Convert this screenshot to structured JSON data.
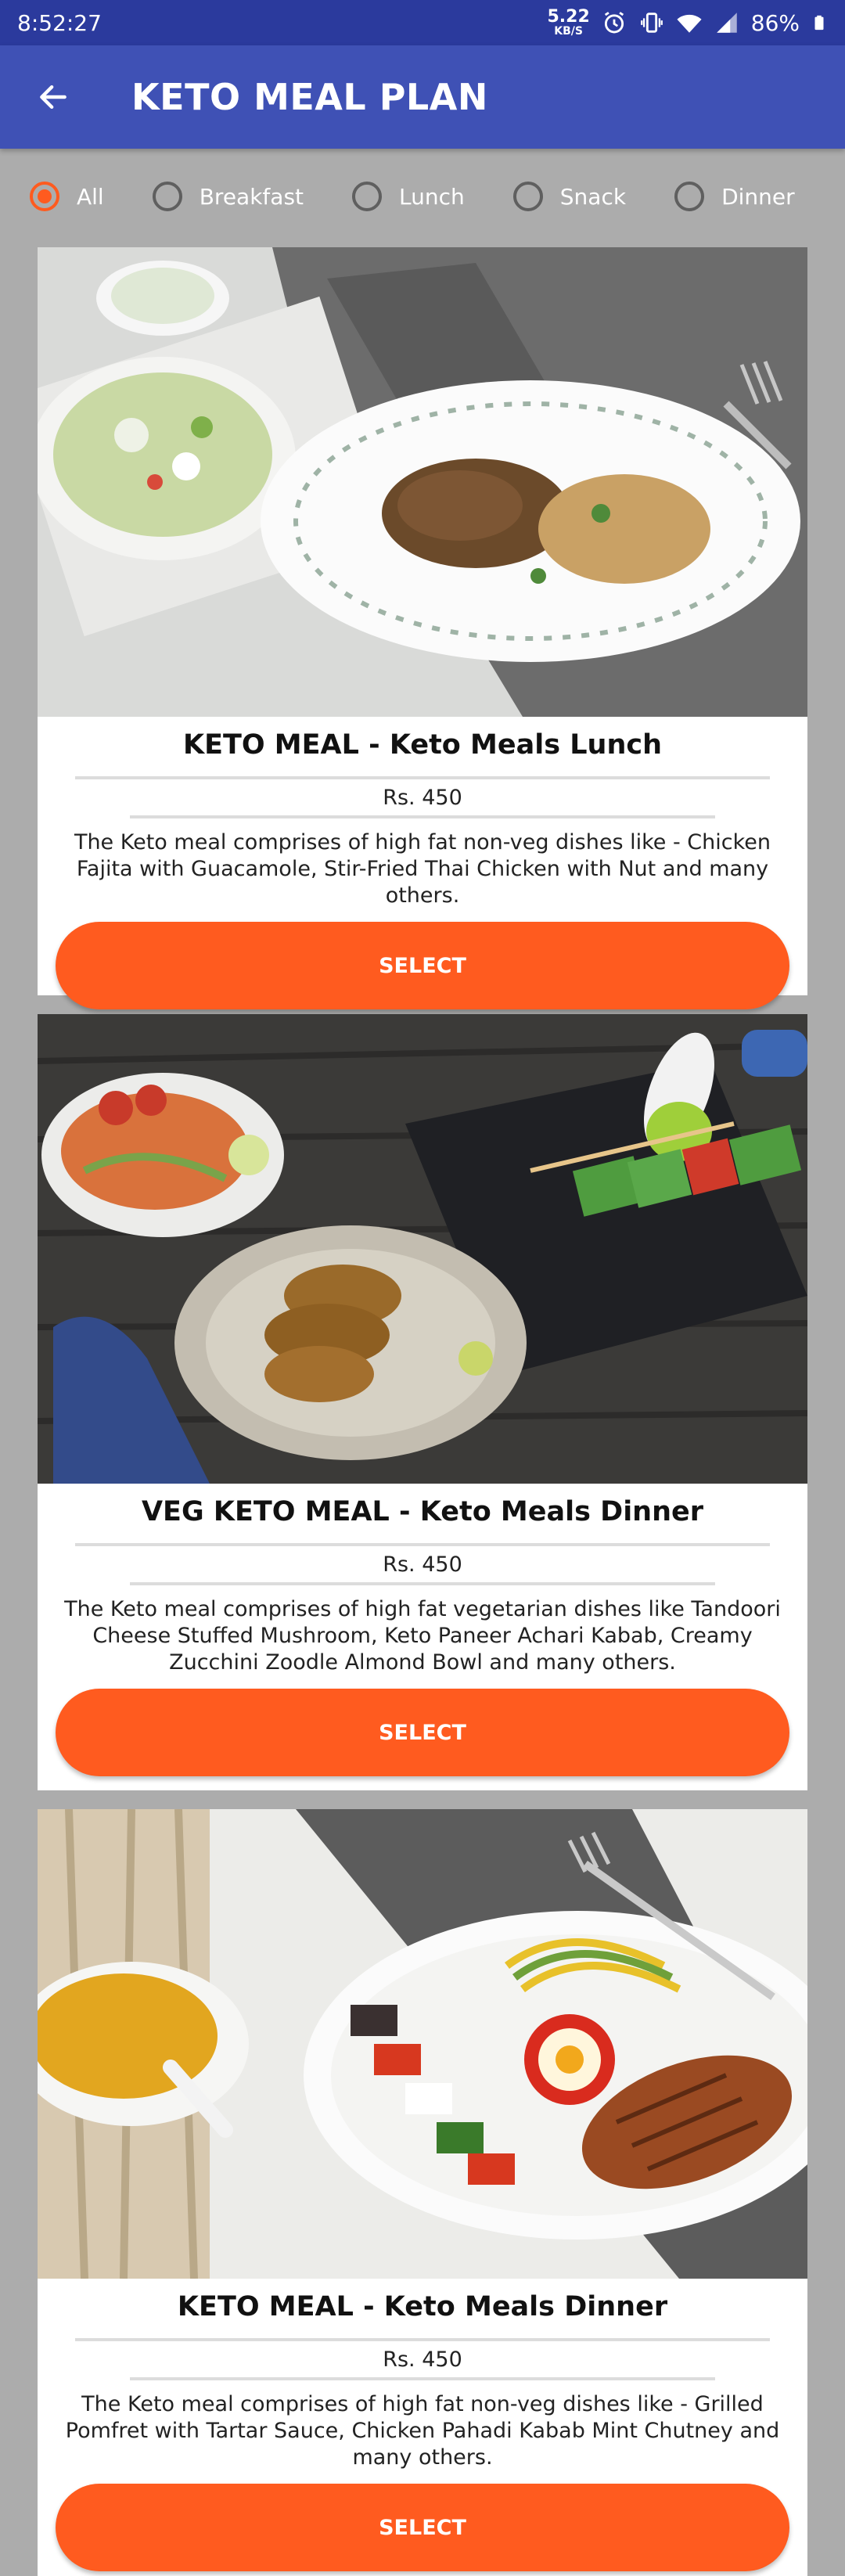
{
  "status_bar": {
    "time": "8:52:27",
    "speed_value": "5.22",
    "speed_unit": "KB/S",
    "battery": "86%"
  },
  "app_bar": {
    "title": "KETO MEAL PLAN",
    "back_icon": "arrow-left-icon"
  },
  "filters": [
    {
      "label": "All",
      "checked": true
    },
    {
      "label": "Breakfast",
      "checked": false
    },
    {
      "label": "Lunch",
      "checked": false
    },
    {
      "label": "Snack",
      "checked": false
    },
    {
      "label": "Dinner",
      "checked": false
    }
  ],
  "meals": [
    {
      "name": "KETO MEAL - Keto Meals  Lunch",
      "price": "Rs. 450",
      "description": "The Keto meal comprises of high fat non-veg dishes like - Chicken Fajita with Guacamole, Stir-Fried Thai Chicken with Nut and many others.",
      "button": "SELECT"
    },
    {
      "name": "VEG KETO MEAL - Keto Meals  Dinner",
      "price": "Rs. 450",
      "description": "The Keto meal comprises of high fat vegetarian dishes like Tandoori Cheese Stuffed Mushroom, Keto Paneer Achari Kabab, Creamy Zucchini Zoodle Almond Bowl and many others.",
      "button": "SELECT"
    },
    {
      "name": "KETO MEAL - Keto Meals  Dinner",
      "price": "Rs. 450",
      "description": "The Keto meal comprises of high fat non-veg dishes like - Grilled Pomfret with Tartar Sauce, Chicken Pahadi Kabab Mint Chutney and many others.",
      "button": "SELECT"
    }
  ],
  "colors": {
    "status_bar": "#2b3a9d",
    "app_bar": "#3f51b5",
    "accent": "#ff5b1f",
    "background": "#acacac"
  }
}
